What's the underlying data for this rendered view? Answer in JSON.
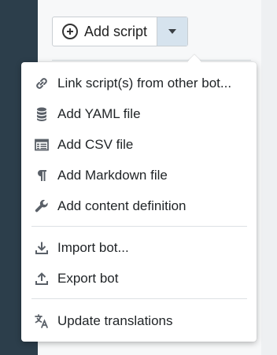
{
  "toolbar": {
    "add_script_label": "Add script"
  },
  "menu": {
    "items": [
      {
        "label": "Link script(s) from other bot...",
        "icon": "link-icon"
      },
      {
        "label": "Add YAML file",
        "icon": "database-icon"
      },
      {
        "label": "Add CSV file",
        "icon": "table-icon"
      },
      {
        "label": "Add Markdown file",
        "icon": "pilcrow-icon"
      },
      {
        "label": "Add content definition",
        "icon": "wrench-icon"
      },
      {
        "label": "Import bot...",
        "icon": "download-icon"
      },
      {
        "label": "Export bot",
        "icon": "upload-icon"
      },
      {
        "label": "Update translations",
        "icon": "translate-icon"
      }
    ]
  },
  "colors": {
    "rail": "#2c3e4b",
    "caret_bg": "#d6e3ee",
    "icon": "#5a6068"
  }
}
